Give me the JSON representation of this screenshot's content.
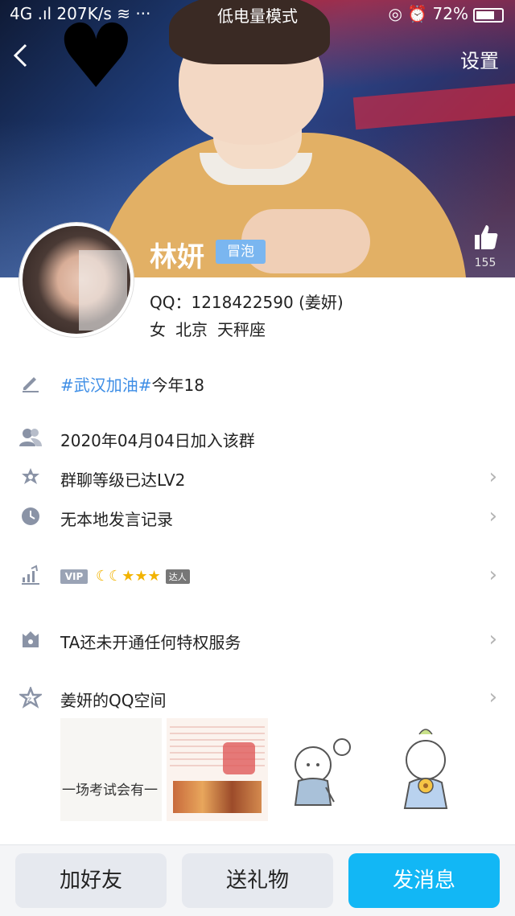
{
  "status_bar": {
    "left": "4G .ıl 207K/s ≋ ···",
    "center": "低电量模式",
    "right": "◎ ⏰ 72%"
  },
  "header": {
    "back_icon": "chevron-left",
    "settings_label": "设置",
    "name": "林妍",
    "badge": "冒泡",
    "like_count": "155"
  },
  "profile": {
    "qq_line": "QQ：1218422590 (姜妍)",
    "gender": "女",
    "city": "北京",
    "zodiac": "天秤座"
  },
  "rows": {
    "signature_hashtag": "#武汉加油#",
    "signature_rest": "今年18",
    "joined": "2020年04月04日加入该群",
    "level": "群聊等级已达LV2",
    "history": "无本地发言记录",
    "vip_tag": "VIP",
    "daren": "达人",
    "privilege": "TA还未开通任何特权服务",
    "qzone": "姜妍的QQ空间"
  },
  "qzone_tiles": {
    "tile1_text": "一场考试会有一"
  },
  "bottom_buttons": {
    "add_friend": "加好友",
    "send_gift": "送礼物",
    "send_message": "发消息"
  },
  "colors": {
    "accent": "#12b7f5",
    "hashtag": "#3e8ee6",
    "badge": "#7ab6f0"
  }
}
